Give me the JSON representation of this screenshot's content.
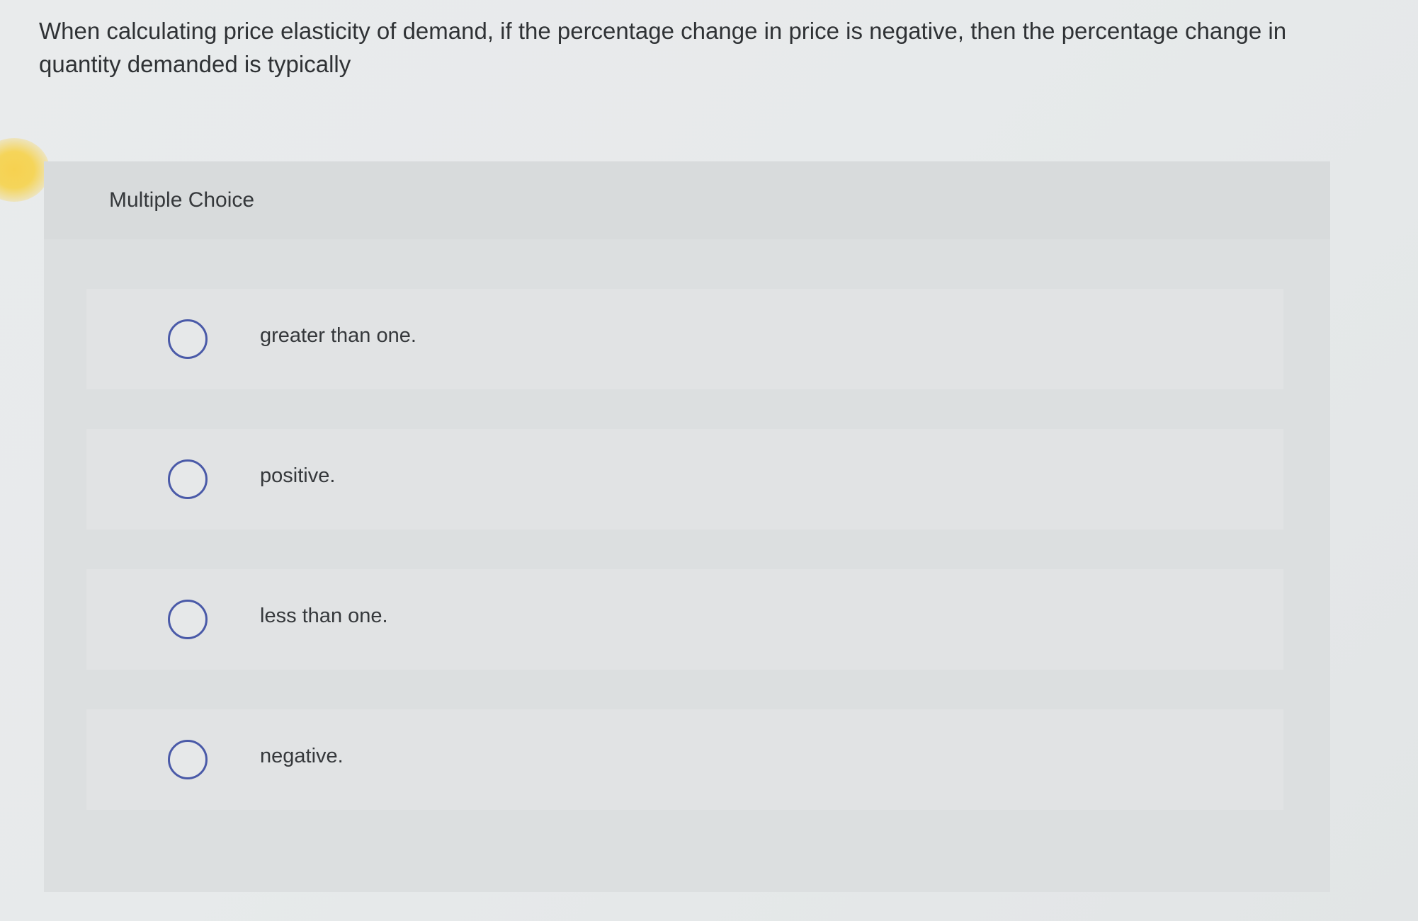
{
  "question": {
    "text": "When calculating price elasticity of demand, if the percentage change in price is negative, then the percentage change in quantity demanded is typically"
  },
  "panel": {
    "header": "Multiple Choice"
  },
  "options": [
    {
      "label": "greater than one."
    },
    {
      "label": "positive."
    },
    {
      "label": "less than one."
    },
    {
      "label": "negative."
    }
  ],
  "colors": {
    "radio_border": "#4a5aa8",
    "background": "#e7eaeb",
    "glare": "#f6d150"
  }
}
